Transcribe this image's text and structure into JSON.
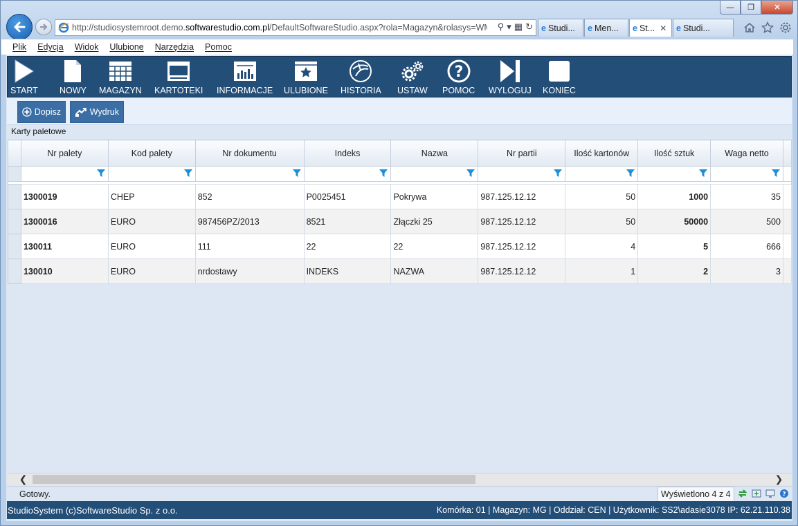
{
  "browser": {
    "url_prefix": "http://studiosystemroot.demo.",
    "url_domain": "softwarestudio.com.pl",
    "url_suffix": "/DefaultSoftwareStudio.aspx?rola=Magazyn&rolasys=WMS",
    "tabs": [
      {
        "label": "Studi...",
        "active": false
      },
      {
        "label": "Men...",
        "active": false
      },
      {
        "label": "St...",
        "active": true
      },
      {
        "label": "Studi...",
        "active": false
      }
    ]
  },
  "menubar": [
    "Plik",
    "Edycja",
    "Widok",
    "Ulubione",
    "Narzędzia",
    "Pomoc"
  ],
  "toolbar": [
    {
      "label": "START",
      "icon": "play-icon"
    },
    {
      "label": "NOWY",
      "icon": "new-document-icon"
    },
    {
      "label": "MAGAZYN",
      "icon": "warehouse-grid-icon"
    },
    {
      "label": "KARTOTEKI",
      "icon": "cards-window-icon"
    },
    {
      "label": "INFORMACJE",
      "icon": "chart-icon"
    },
    {
      "label": "ULUBIONE",
      "icon": "favorite-star-icon"
    },
    {
      "label": "HISTORIA",
      "icon": "history-icon"
    },
    {
      "label": "USTAW",
      "icon": "gears-icon"
    },
    {
      "label": "POMOC",
      "icon": "help-icon"
    },
    {
      "label": "WYLOGUJ",
      "icon": "logout-icon"
    },
    {
      "label": "KONIEC",
      "icon": "stop-icon"
    }
  ],
  "actions": {
    "add_label": "Dopisz",
    "print_label": "Wydruk"
  },
  "section_title": "Karty paletowe",
  "grid": {
    "columns": [
      "Nr palety",
      "Kod palety",
      "Nr dokumentu",
      "Indeks",
      "Nazwa",
      "Nr partii",
      "Ilość kartonów",
      "Ilość sztuk",
      "Waga netto"
    ],
    "rows": [
      [
        "1300019",
        "CHEP",
        "852",
        "P0025451",
        "Pokrywa",
        "987.125.12.12",
        "50",
        "1000",
        "35"
      ],
      [
        "1300016",
        "EURO",
        "987456PZ/2013",
        "8521",
        "Złączki 25",
        "987.125.12.12",
        "50",
        "50000",
        "500"
      ],
      [
        "130011",
        "EURO",
        "111",
        "22",
        "22",
        "987.125.12.12",
        "4",
        "5",
        "666"
      ],
      [
        "130010",
        "EURO",
        "nrdostawy",
        "INDEKS",
        "NAZWA",
        "987.125.12.12",
        "1",
        "2",
        "3"
      ]
    ]
  },
  "status": {
    "ready": "Gotowy.",
    "counter": "Wyświetlono 4 z 4"
  },
  "footer": {
    "left": "StudioSystem (c)SoftwareStudio Sp. z o.o.",
    "right": "Komórka: 01 | Magazyn: MG | Oddział: CEN | Użytkownik: SS2\\adasie3078 IP: 62.21.110.38"
  },
  "colors": {
    "toolbar_bg": "#234e78",
    "action_btn": "#3a6ea5",
    "filter_icon": "#1f8fd6"
  }
}
